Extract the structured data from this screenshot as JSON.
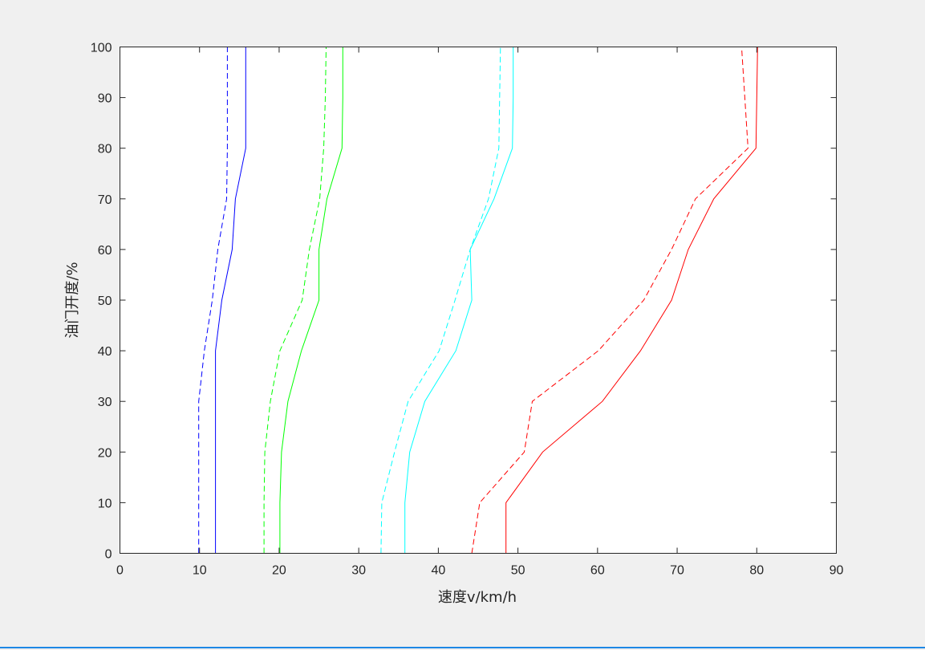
{
  "chart_data": {
    "type": "line",
    "title": "",
    "xlabel": "速度v/km/h",
    "ylabel": "油门开度/%",
    "xlim": [
      0,
      90
    ],
    "ylim": [
      0,
      100
    ],
    "xticks": [
      "0",
      "10",
      "20",
      "30",
      "40",
      "50",
      "60",
      "70",
      "80",
      "90"
    ],
    "yticks": [
      "0",
      "10",
      "20",
      "30",
      "40",
      "50",
      "60",
      "70",
      "80",
      "90",
      "100"
    ],
    "grid": false,
    "legend": null,
    "y": [
      0,
      10,
      20,
      30,
      40,
      50,
      60,
      70,
      80,
      90,
      100
    ],
    "series": [
      {
        "name": "blue-solid",
        "color": "#0000ff",
        "style": "solid",
        "x": [
          12.0,
          12.0,
          12.0,
          12.0,
          12.0,
          12.8,
          14.1,
          14.5,
          15.8,
          15.8,
          15.8
        ]
      },
      {
        "name": "blue-dashed",
        "color": "#0000ff",
        "style": "dashed",
        "x": [
          9.9,
          9.9,
          9.9,
          9.9,
          10.6,
          11.6,
          12.3,
          13.4,
          13.5,
          13.5,
          13.5
        ]
      },
      {
        "name": "green-solid",
        "color": "#00ff00",
        "style": "solid",
        "x": [
          20.1,
          20.1,
          20.3,
          21.1,
          22.8,
          25.0,
          25.0,
          26.0,
          27.9,
          28.0,
          28.0
        ]
      },
      {
        "name": "green-dashed",
        "color": "#00ff00",
        "style": "dashed",
        "x": [
          18.1,
          18.1,
          18.2,
          18.9,
          20.1,
          22.9,
          23.8,
          25.1,
          25.6,
          25.8,
          25.9
        ]
      },
      {
        "name": "cyan-solid",
        "color": "#00ffff",
        "style": "solid",
        "x": [
          35.8,
          35.8,
          36.4,
          38.3,
          42.2,
          44.2,
          44.0,
          47.0,
          49.3,
          49.4,
          49.4
        ]
      },
      {
        "name": "cyan-dashed",
        "color": "#00ffff",
        "style": "dashed",
        "x": [
          32.8,
          32.9,
          34.5,
          36.2,
          40.1,
          42.1,
          44.0,
          46.3,
          47.6,
          47.7,
          47.8
        ]
      },
      {
        "name": "red-solid",
        "color": "#ff0000",
        "style": "solid",
        "x": [
          48.5,
          48.5,
          53.1,
          60.6,
          65.4,
          69.3,
          71.4,
          74.6,
          79.9,
          80.0,
          80.1
        ]
      },
      {
        "name": "red-dashed",
        "color": "#ff0000",
        "style": "dashed",
        "x": [
          44.2,
          45.2,
          50.8,
          51.8,
          60.1,
          65.8,
          69.3,
          72.3,
          78.9,
          78.5,
          78.1
        ]
      }
    ]
  }
}
